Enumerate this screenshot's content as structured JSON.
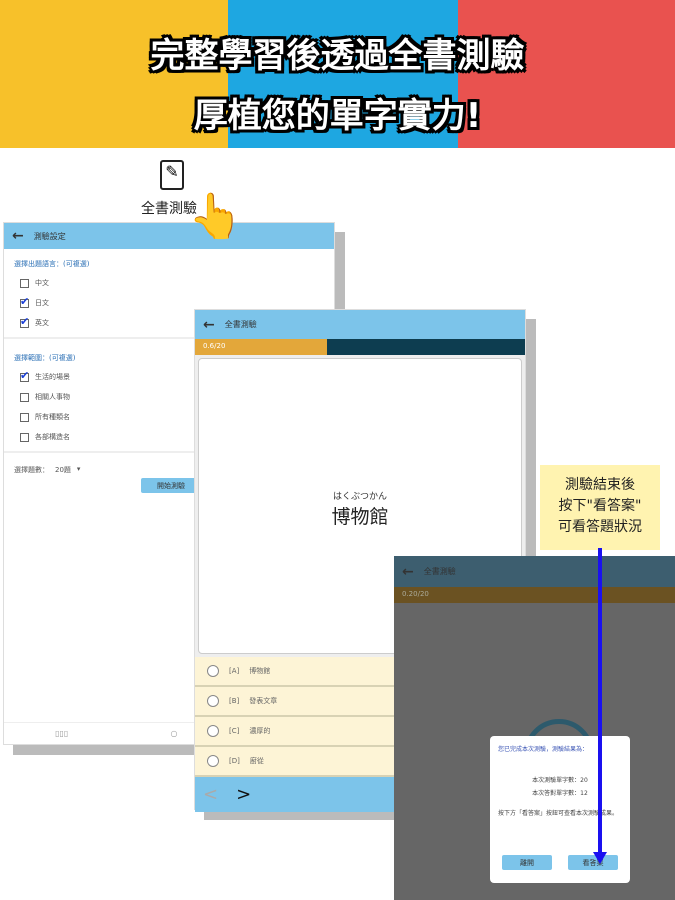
{
  "banner": {
    "line1": "完整學習後透過全書測驗",
    "line2": "厚植您的單字實力!",
    "colors": [
      "#f7c12a",
      "#1ea7e1",
      "#e9524f"
    ]
  },
  "entry": {
    "label": "全書測驗",
    "icon": "edit-note-icon"
  },
  "settings": {
    "title": "測驗設定",
    "lang_label": "選擇出題語言：(可複選)",
    "langs": [
      {
        "label": "中文",
        "checked": false
      },
      {
        "label": "日文",
        "checked": true
      },
      {
        "label": "英文",
        "checked": true
      }
    ],
    "range_label": "選擇範圍：(可複選)",
    "ranges": [
      {
        "label": "生活的場景",
        "checked": true
      },
      {
        "label": "相關人事物",
        "checked": false
      },
      {
        "label": "所有種類名",
        "checked": false
      },
      {
        "label": "各部構造名",
        "checked": false
      }
    ],
    "count_label": "選擇題數：",
    "count_value": "20題",
    "start_button": "開始測驗"
  },
  "quiz": {
    "title": "全書測驗",
    "progress_text": "0.6/20",
    "progress": 0.4,
    "furigana": "はくぶつかん",
    "word": "博物館",
    "options": [
      {
        "key": "[A]",
        "text": "博物館"
      },
      {
        "key": "[B]",
        "text": "發表文章"
      },
      {
        "key": "[C]",
        "text": "濃厚的"
      },
      {
        "key": "[D]",
        "text": "廚從"
      }
    ]
  },
  "note": {
    "line1": "測驗結束後",
    "line2": "按下\"看答案\"",
    "line3": "可看答題狀況"
  },
  "result": {
    "title": "全書測驗",
    "progress_text": "0.20/20",
    "dialog_title": "您已完成本次測驗，測驗結果為：",
    "total": "本次測驗單字數：20",
    "correct": "本次答對單字數：12",
    "hint": "按下方「看答案」按鈕可查看本次測驗成果。",
    "close_button": "離開",
    "answer_button": "看答案"
  }
}
